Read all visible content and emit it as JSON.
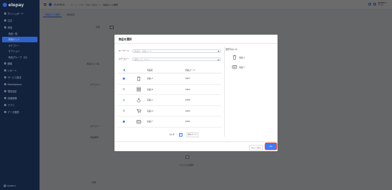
{
  "app": {
    "logo_text": "elepay",
    "store_name": "ELEPAY.S"
  },
  "breadcrumb": [
    "ホーム",
    "Ichibr",
    "商品",
    "商品セット",
    "商品セット詳細"
  ],
  "user": {
    "line1": "ELEPAY.S",
    "line2": "テスト"
  },
  "sidebar": {
    "items": [
      {
        "label": "ダッシュボード"
      },
      {
        "label": "注文"
      },
      {
        "label": "商品"
      },
      {
        "label": "商品一覧",
        "sub": true
      },
      {
        "label": "商品セット",
        "sub": true,
        "active": true
      },
      {
        "label": "カテゴリー",
        "sub": true
      },
      {
        "label": "モプション",
        "sub": true
      },
      {
        "label": "商品グループ（ロ）",
        "sub": true
      },
      {
        "label": "顧客"
      },
      {
        "label": "レポート"
      },
      {
        "label": "サービス設定"
      },
      {
        "label": "Marketplace"
      },
      {
        "label": "運営設定"
      },
      {
        "label": "情報管理"
      },
      {
        "label": "アプリ"
      },
      {
        "label": "データ連携"
      }
    ],
    "footer": "ELEPAY.S"
  },
  "page": {
    "tabs": [
      {
        "label": "商品セット情報",
        "active": true
      },
      {
        "label": "関連設定"
      }
    ],
    "bg_labels": [
      "写真",
      "商品セット名",
      "カテゴリー",
      "カテゴリー",
      "商品順序",
      "分類"
    ],
    "bg_upload_text": "ファイルを選択"
  },
  "modal": {
    "title": "商品を選択",
    "keyword_label": "キーワード",
    "keyword_placeholder": "商品名、商品コード",
    "category_label": "カテゴリー",
    "category_placeholder": "選択してください",
    "columns": {
      "name": "商品名",
      "code": "商品コード"
    },
    "rows": [
      {
        "name": "商品 A",
        "code": "0007",
        "checked": true,
        "icon": "bucket-icon"
      },
      {
        "name": "商品 B",
        "code": "0003",
        "checked": false,
        "icon": "stack-icon"
      },
      {
        "name": "商品 C",
        "code": "0008",
        "checked": false,
        "icon": "bag-icon"
      },
      {
        "name": "商品 D",
        "code": "0005",
        "checked": false,
        "icon": "cart-icon"
      },
      {
        "name": "商品 F",
        "code": "0006",
        "checked": true,
        "icon": "box-icon"
      }
    ],
    "pager": {
      "total": "全6 件",
      "current": "1",
      "size": "5件/ページ"
    },
    "selected_title": "選択済み (2)",
    "selected": [
      {
        "name": "商品 A",
        "icon": "bucket-icon"
      },
      {
        "name": "商品 F",
        "icon": "box-icon"
      }
    ],
    "cancel_label": "キャンセル",
    "ok_label": "OK"
  }
}
